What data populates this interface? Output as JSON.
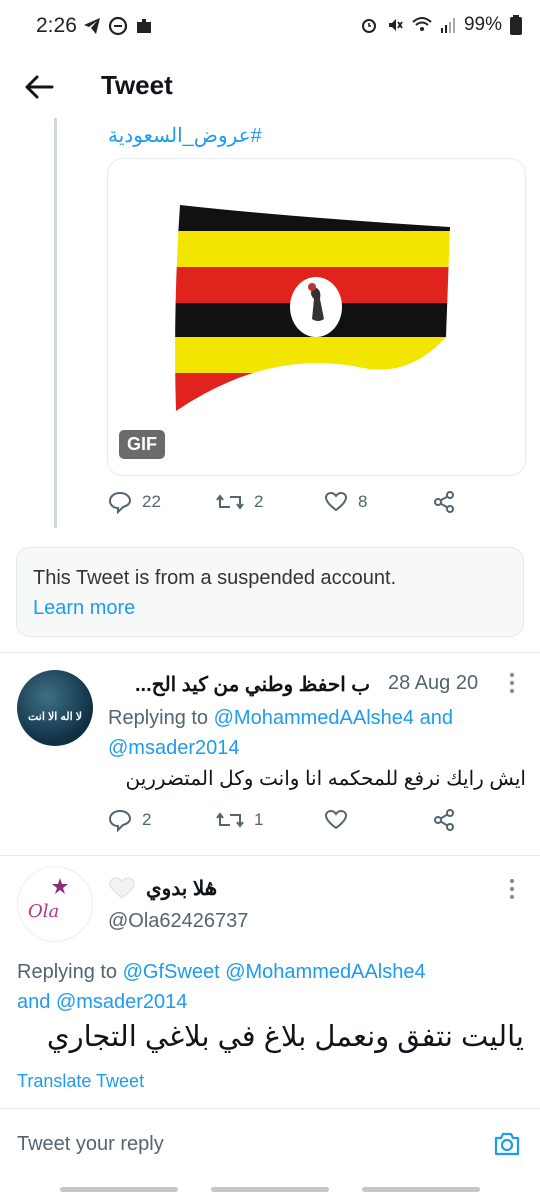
{
  "status": {
    "time": "2:26",
    "battery": "99%"
  },
  "header": {
    "title": "Tweet"
  },
  "tweet1": {
    "hashtag": "#عروض_السعودية",
    "gif_label": "GIF",
    "replies": "22",
    "retweets": "2",
    "likes": "8"
  },
  "notice": {
    "text": "This Tweet is from a suspended account.",
    "link": "Learn more"
  },
  "reply1": {
    "name": "ب احفظ وطني من كيد الح...",
    "date": "28 Aug 20",
    "replying_prefix": "Replying to",
    "mention1": "@MohammedAAlshe4",
    "and": "and",
    "mention2": "@msader2014",
    "text": "ايش رايك نرفع للمحكمه انا وانت وكل المتضررين",
    "avatar_text": "لا اله الا انت",
    "replies": "2",
    "retweets": "1",
    "likes": ""
  },
  "reply2": {
    "name": "ۿلا بدوي",
    "handle": "@Ola62426737",
    "avatar_text": "Ola",
    "replying_prefix": "Replying to",
    "mention1": "@GfSweet",
    "mention2": "@MohammedAAlshe4",
    "and": "and",
    "mention3": "@msader2014",
    "text": "ياليت نتفق ونعمل بلاغ في بلاغي التجاري",
    "translate": "Translate Tweet"
  },
  "composer": {
    "placeholder": "Tweet your reply"
  },
  "colors": {
    "accent": "#1d9bf0",
    "muted": "#536471"
  }
}
